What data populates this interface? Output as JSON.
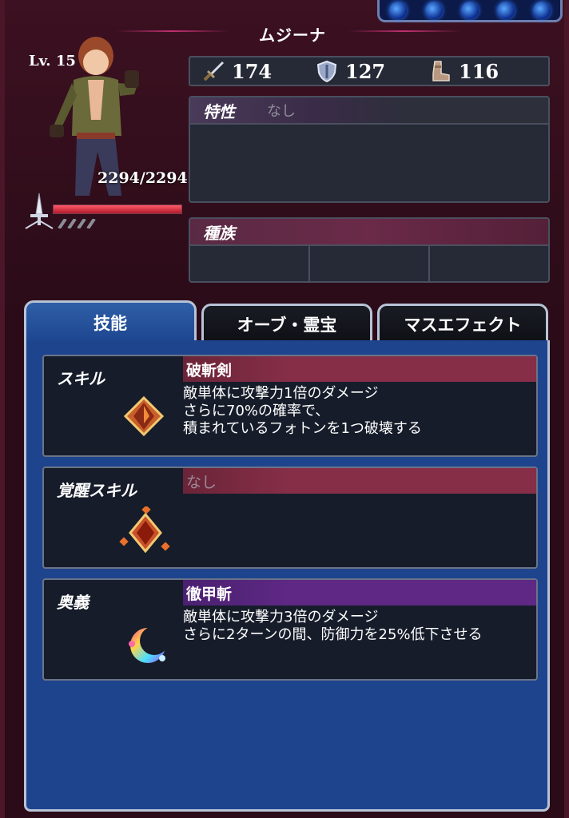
{
  "character": {
    "name": "ムジーナ",
    "level": "Lv. 15",
    "hp": "2294/2294",
    "hp_fraction": 1.0
  },
  "stats": {
    "attack": "174",
    "defense": "127",
    "speed": "116"
  },
  "traits": {
    "title": "特性",
    "value": "なし"
  },
  "race": {
    "title": "種族"
  },
  "tabs": [
    {
      "label": "技能",
      "active": true
    },
    {
      "label": "オーブ・霊宝",
      "active": false
    },
    {
      "label": "マスエフェクト",
      "active": false
    }
  ],
  "skills": [
    {
      "label": "スキル",
      "name": "破斬剣",
      "desc": [
        "敵単体に攻撃力1倍のダメージ",
        "さらに70%の確率で、",
        "積まれているフォトンを1つ破壊する"
      ]
    },
    {
      "label": "覚醒スキル",
      "name": "なし",
      "desc": []
    },
    {
      "label": "奥義",
      "name": "徹甲斬",
      "desc": [
        "敵単体に攻撃力3倍のダメージ",
        "さらに2ターンの間、防御力を25%低下させる"
      ]
    }
  ],
  "colors": {
    "frame": "#2a0b17",
    "tab_active": "#1e448e",
    "skill_bar": "#862e48",
    "ultimate_bar": "#5e2884"
  }
}
